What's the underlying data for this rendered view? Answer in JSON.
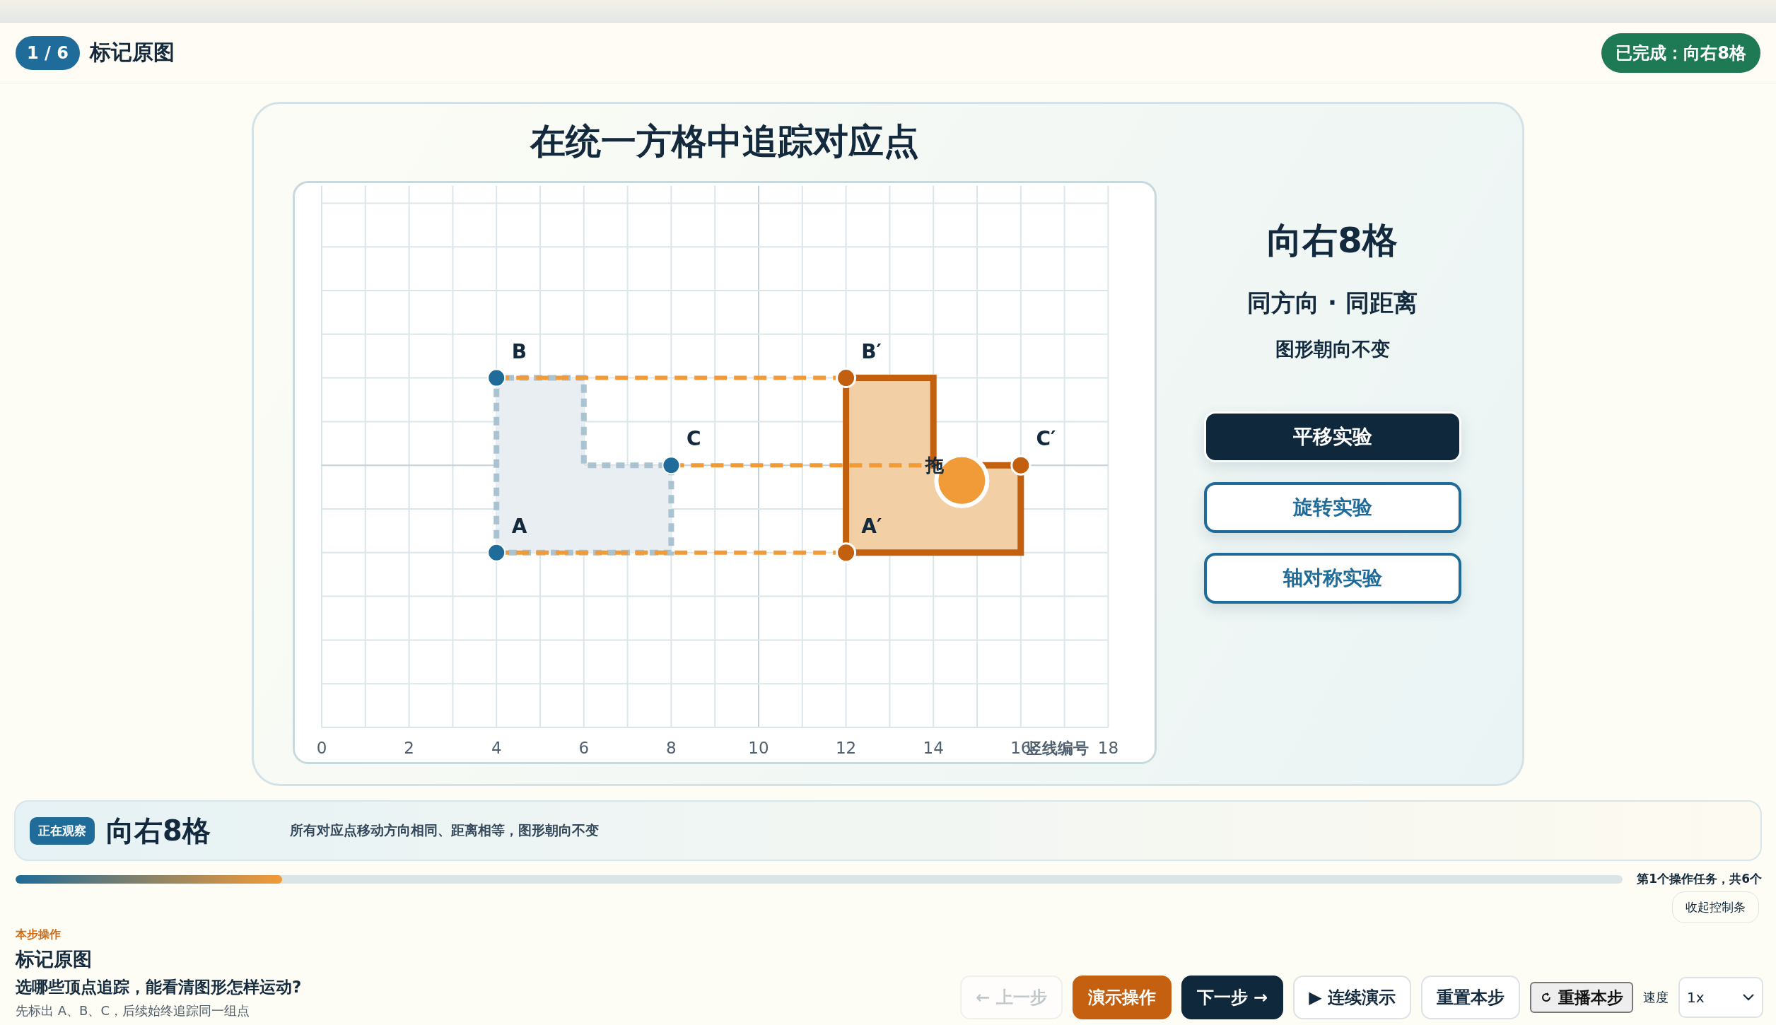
{
  "header": {
    "step_badge": "1 / 6",
    "title": "标记原图",
    "status_badge": "已完成：向右8格"
  },
  "experiment": {
    "title": "在统一方格中追踪对应点",
    "grid": {
      "xticks": [
        "0",
        "2",
        "4",
        "6",
        "8",
        "10",
        "12",
        "14",
        "16",
        "18"
      ],
      "axis_label": "竖线编号",
      "drag_label": "拖",
      "original_points": [
        {
          "label": "A"
        },
        {
          "label": "B"
        },
        {
          "label": "C"
        }
      ],
      "image_points": [
        {
          "label": "A′"
        },
        {
          "label": "B′"
        },
        {
          "label": "C′"
        }
      ]
    },
    "summary": {
      "headline": "向右8格",
      "subtitle": "同方向 · 同距离",
      "note": "图形朝向不变"
    },
    "modes": [
      {
        "label": "平移实验",
        "selected": true
      },
      {
        "label": "旋转实验",
        "selected": false
      },
      {
        "label": "轴对称实验",
        "selected": false
      }
    ]
  },
  "observation": {
    "badge": "正在观察",
    "title": "向右8格",
    "description": "所有对应点移动方向相同、距离相等，图形朝向不变"
  },
  "progress": {
    "level": 0.166,
    "caption": "第1个操作任务，共6个"
  },
  "collapse_button": "收起控制条",
  "step_panel": {
    "eyebrow": "本步操作",
    "title": "标记原图",
    "question": "选哪些顶点追踪，能看清图形怎样运动?",
    "hint": "先标出 A、B、C，后续始终追踪同一组点"
  },
  "controls": [
    {
      "label": "← 上一步",
      "kind": "ghost",
      "disabled": true
    },
    {
      "label": "演示操作",
      "kind": "accent",
      "disabled": false
    },
    {
      "label": "下一步 →",
      "kind": "primary",
      "disabled": false
    },
    {
      "label": "▶ 连续演示",
      "kind": "outline",
      "disabled": false
    },
    {
      "label": "重置本步",
      "kind": "outline",
      "disabled": false
    },
    {
      "label": "重播本步",
      "kind": "system",
      "disabled": false
    }
  ],
  "speed": {
    "label": "速度",
    "value": "1x"
  }
}
